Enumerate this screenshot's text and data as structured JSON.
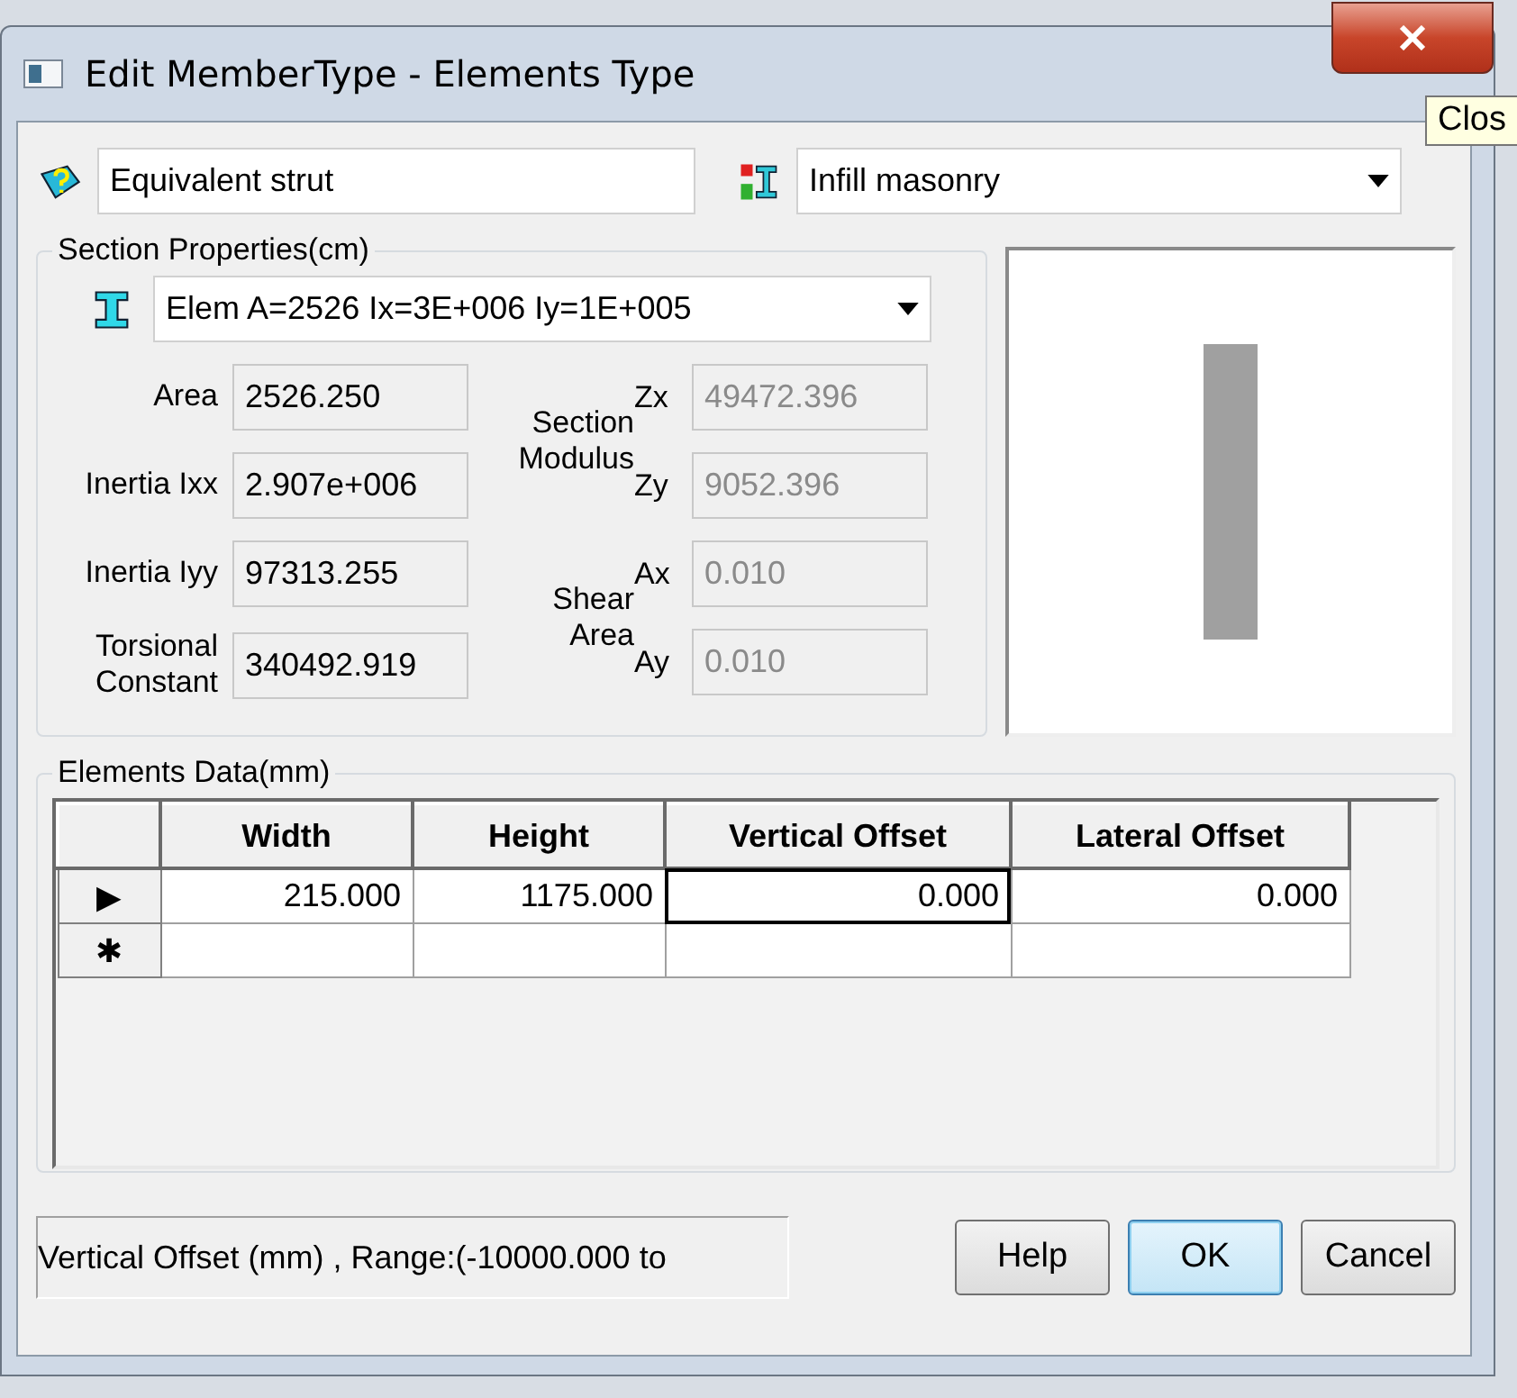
{
  "window": {
    "title": "Edit MemberType - Elements Type",
    "tooltip": "Clos"
  },
  "name_field": {
    "value": "Equivalent strut"
  },
  "type_dropdown": {
    "value": "Infill  masonry"
  },
  "section_properties": {
    "title": "Section Properties(cm)",
    "section_dropdown": {
      "value": "Elem A=2526 Ix=3E+006 Iy=1E+005"
    },
    "left_fields": [
      {
        "label": "Area",
        "value": "2526.250",
        "disabled": false
      },
      {
        "label": "Inertia Ixx",
        "value": "2.907e+006",
        "disabled": false
      },
      {
        "label": "Inertia Iyy",
        "value": "97313.255",
        "disabled": false
      },
      {
        "label": "Torsional Constant",
        "value": "340492.919",
        "disabled": false
      }
    ],
    "groups": [
      {
        "label": "Section Modulus",
        "fields": [
          {
            "label": "Zx",
            "value": "49472.396",
            "disabled": true
          },
          {
            "label": "Zy",
            "value": "9052.396",
            "disabled": true
          }
        ]
      },
      {
        "label": "Shear Area",
        "fields": [
          {
            "label": "Ax",
            "value": "0.010",
            "disabled": true
          },
          {
            "label": "Ay",
            "value": "0.010",
            "disabled": true
          }
        ]
      }
    ]
  },
  "elements_data": {
    "title": "Elements Data(mm)",
    "columns": [
      "Width",
      "Height",
      "Vertical Offset",
      "Lateral Offset"
    ],
    "rows": [
      {
        "marker": "▶",
        "cells": [
          {
            "value": "215.000",
            "selected": false
          },
          {
            "value": "1175.000",
            "selected": false
          },
          {
            "value": "0.000",
            "selected": true
          },
          {
            "value": "0.000",
            "selected": false
          }
        ]
      },
      {
        "marker": "✱",
        "cells": [
          {
            "selected": false
          },
          {
            "selected": false
          },
          {
            "selected": false
          },
          {
            "selected": false
          }
        ]
      }
    ]
  },
  "status_bar": {
    "text": "Vertical Offset (mm) , Range:(-10000.000 to"
  },
  "buttons": [
    {
      "label": "Help",
      "default": false
    },
    {
      "label": "OK",
      "default": true
    },
    {
      "label": "Cancel",
      "default": false
    }
  ]
}
